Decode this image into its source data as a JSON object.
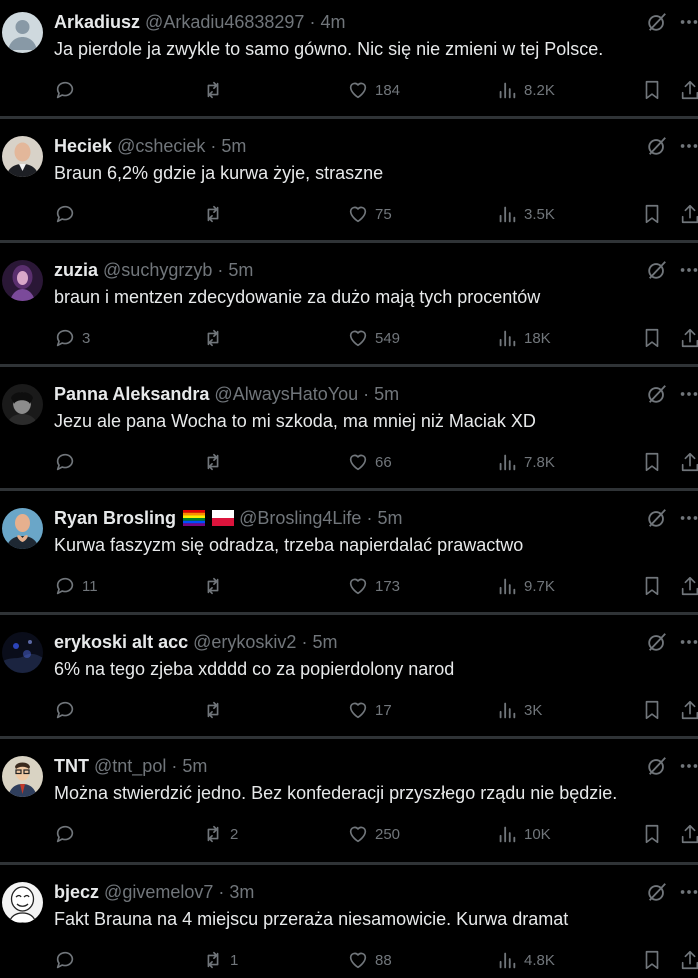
{
  "tweets": [
    {
      "name": "Arkadiusz",
      "handle": "@Arkadiu46838297",
      "time": "4m",
      "text": "Ja pierdole ja zwykle to samo gówno. Nic się nie zmieni w tej Polsce.",
      "replies": "",
      "retweets": "",
      "likes": "184",
      "views": "8.2K",
      "avatar": "default-avatar",
      "flags": []
    },
    {
      "name": "Heciek",
      "handle": "@csheciek",
      "time": "5m",
      "text": "Braun 6,2% gdzie ja kurwa żyje, straszne",
      "replies": "",
      "retweets": "",
      "likes": "75",
      "views": "3.5K",
      "avatar": "photo-man-suit",
      "flags": []
    },
    {
      "name": "zuzia",
      "handle": "@suchygrzyb",
      "time": "5m",
      "text": "braun i mentzen zdecydowanie za dużo mają tych procentów",
      "replies": "3",
      "retweets": "",
      "likes": "549",
      "views": "18K",
      "avatar": "photo-purple-girl",
      "flags": []
    },
    {
      "name": "Panna Aleksandra",
      "handle": "@AlwaysHatoYou",
      "time": "5m",
      "text": "Jezu ale pana Wocha to mi szkoda, ma mniej niż Maciak XD",
      "replies": "",
      "retweets": "",
      "likes": "66",
      "views": "7.8K",
      "avatar": "photo-dark-face",
      "flags": []
    },
    {
      "name": "Ryan Brosling",
      "handle": "@Brosling4Life",
      "time": "5m",
      "text": "Kurwa faszyzm się odradza, trzeba napierdalać prawactwo",
      "replies": "11",
      "retweets": "",
      "likes": "173",
      "views": "9.7K",
      "avatar": "photo-man-heart-hands",
      "flags": [
        "rainbow-flag",
        "poland-flag"
      ]
    },
    {
      "name": "erykoski alt acc",
      "handle": "@erykoskiv2",
      "time": "5m",
      "text": "6% na tego zjeba xdddd co za popierdolony narod",
      "replies": "",
      "retweets": "",
      "likes": "17",
      "views": "3K",
      "avatar": "photo-night-scene",
      "flags": []
    },
    {
      "name": "TNT",
      "handle": "@tnt_pol",
      "time": "5m",
      "text": "Można stwierdzić jedno. Bez konfederacji przyszłego rządu nie będzie.",
      "replies": "",
      "retweets": "2",
      "likes": "250",
      "views": "10K",
      "avatar": "cartoon-man-glasses",
      "flags": []
    },
    {
      "name": "bjecz",
      "handle": "@givemelov7",
      "time": "3m",
      "text": "Fakt Brauna na 4 miejscu przeraża niesamowicie. Kurwa dramat",
      "replies": "",
      "retweets": "1",
      "likes": "88",
      "views": "4.8K",
      "avatar": "meme-face-drawing",
      "flags": []
    }
  ]
}
